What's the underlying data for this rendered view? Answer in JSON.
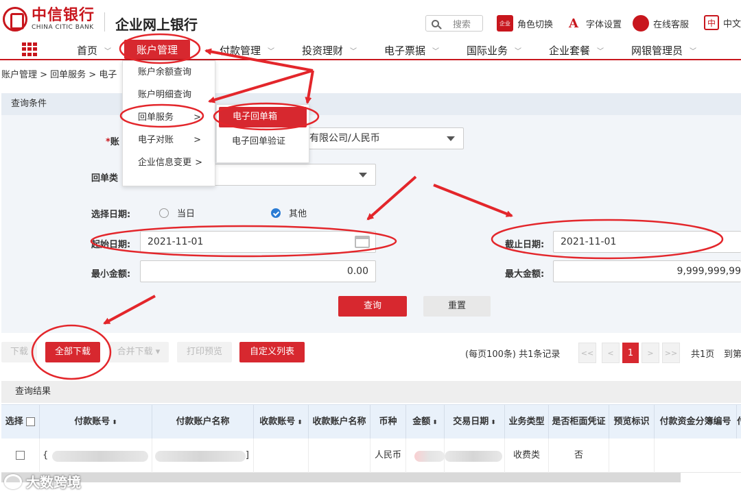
{
  "header": {
    "bank_name_cn": "中信银行",
    "bank_name_en": "CHINA CITIC BANK",
    "product_title": "企业网上银行",
    "search_placeholder": "搜索",
    "role_switch": "角色切换",
    "role_icon_text": "企业",
    "font_settings": "字体设置",
    "font_icon_text": "A",
    "online_service": "在线客服",
    "language": "中文",
    "language_icon_text": "中"
  },
  "nav": {
    "items": [
      {
        "label": "首页"
      },
      {
        "label": "账户管理",
        "active": true
      },
      {
        "label": "付款管理"
      },
      {
        "label": "投资理财"
      },
      {
        "label": "电子票据"
      },
      {
        "label": "国际业务"
      },
      {
        "label": "企业套餐"
      },
      {
        "label": "网银管理员"
      }
    ],
    "chevron": "﹀"
  },
  "breadcrumb": "账户管理 > 回单服务 > 电子",
  "menu": {
    "level1": [
      {
        "label": "账户余额查询",
        "arrow": ""
      },
      {
        "label": "账户明细查询",
        "arrow": ""
      },
      {
        "label": "回单服务",
        "arrow": ">"
      },
      {
        "label": "电子对账",
        "arrow": ">"
      },
      {
        "label": "企业信息变更",
        "arrow": ">"
      }
    ],
    "level2": [
      {
        "label": "电子回单箱",
        "highlighted": true
      },
      {
        "label": "电子回单验证"
      }
    ]
  },
  "query": {
    "panel_title": "查询条件",
    "account_label": "账",
    "account_value": "有限公司/人民币",
    "receipt_type_label": "回单类",
    "date_select_label": "选择日期:",
    "radio_today": "当日",
    "radio_other": "其他",
    "start_date_label": "起始日期:",
    "start_date_value": "2021-11-01",
    "end_date_label": "截止日期:",
    "end_date_value": "2021-11-01",
    "min_amount_label": "最小金额:",
    "min_amount_value": "0.00",
    "max_amount_label": "最大金额:",
    "max_amount_value": "9,999,999,99",
    "query_button": "查询",
    "reset_button": "重置"
  },
  "toolbar": {
    "download": "下载",
    "download_all": "全部下载",
    "merge_download": "合并下载 ▾",
    "print_preview": "打印预览",
    "custom_columns": "自定义列表",
    "records_info": "(每页100条) 共1条记录",
    "pager_first": "<<",
    "pager_prev": "<",
    "pager_current": "1",
    "pager_next": ">",
    "pager_last": ">>",
    "total_pages": "共1页",
    "goto": "到第"
  },
  "results": {
    "title": "查询结果",
    "columns": [
      "选择",
      "付款账号",
      "付款账户名称",
      "收款账号",
      "收款账户名称",
      "币种",
      "金额",
      "交易日期",
      "业务类型",
      "是否柜面凭证",
      "预览标识",
      "付款资金分簿编号",
      "付"
    ],
    "sort_mark": "⬍",
    "rows": [
      {
        "payer_prefix": "{",
        "payer_name_suffix": "]",
        "currency": "人民币",
        "business_type": "收费类",
        "counter_voucher": "否"
      }
    ]
  },
  "watermark": "大数跨境",
  "annotation_color": "#e3262b"
}
